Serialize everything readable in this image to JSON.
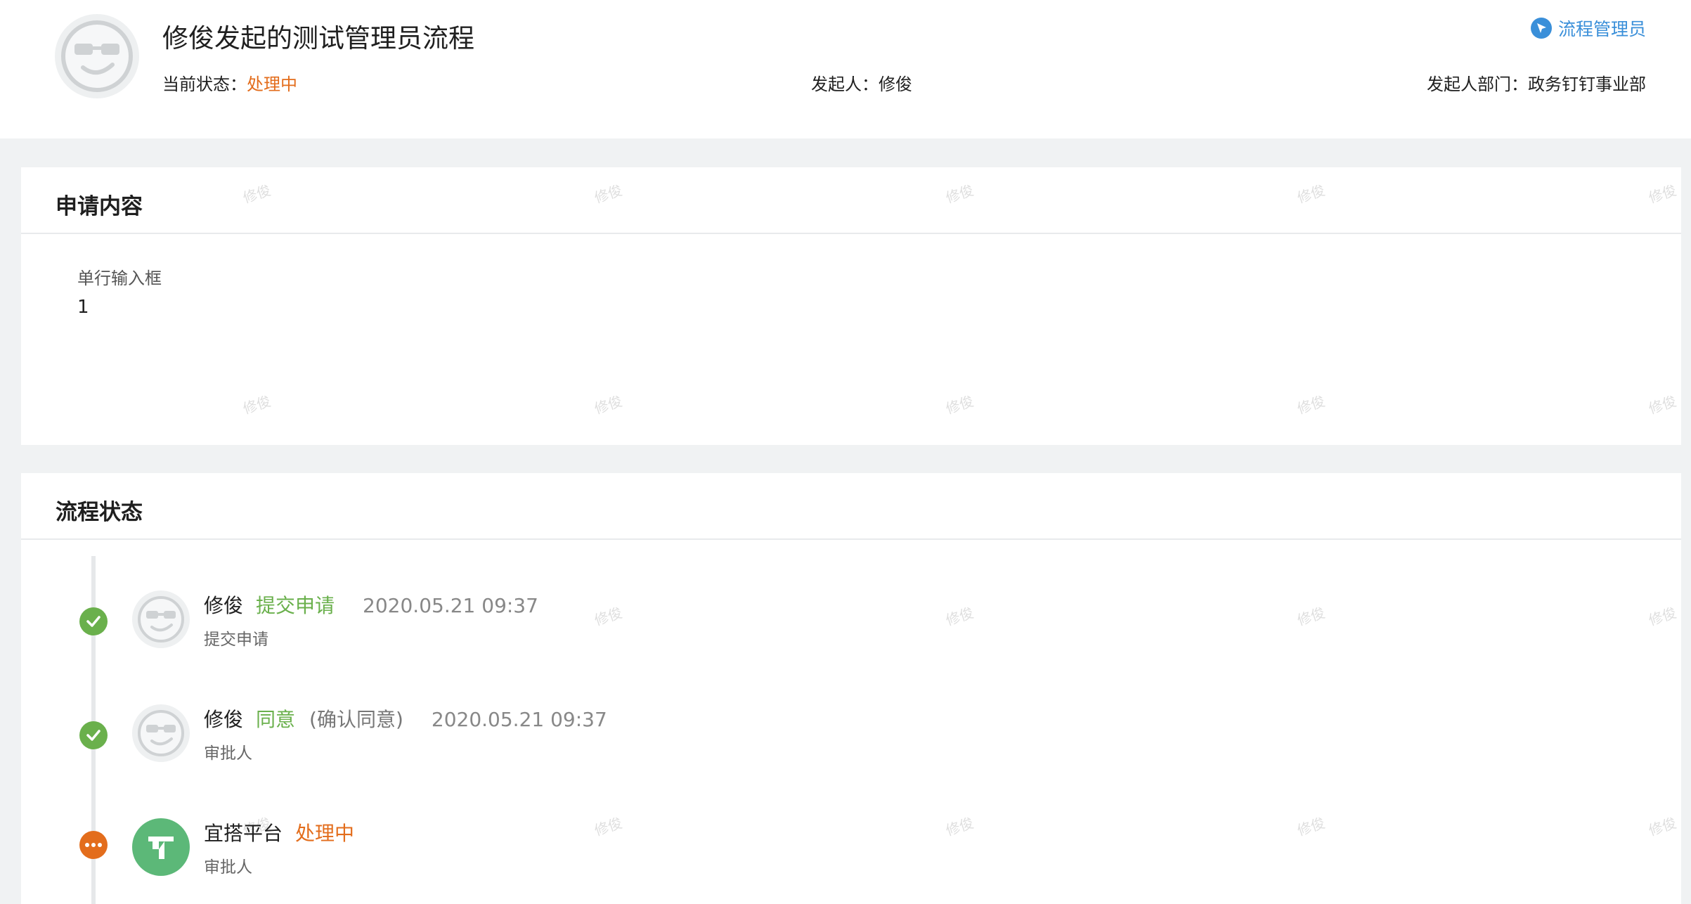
{
  "header": {
    "title": "修俊发起的测试管理员流程",
    "status_label": "当前状态：",
    "status_value": "处理中",
    "initiator_label": "发起人：",
    "initiator_value": "修俊",
    "dept_label": "发起人部门：",
    "dept_value": "政务钉钉事业部",
    "admin_link": "流程管理员",
    "avatar_icon": "sunglasses-face-icon"
  },
  "apply": {
    "title": "申请内容",
    "fields": [
      {
        "label": "单行输入框",
        "value": "1"
      }
    ]
  },
  "flow": {
    "title": "流程状态",
    "items": [
      {
        "name": "修俊",
        "action": "提交申请",
        "remark": "",
        "time": "2020.05.21 09:37",
        "role": "提交申请",
        "state": "done",
        "state_icon": "check-icon",
        "avatar_icon": "sunglasses-face-icon"
      },
      {
        "name": "修俊",
        "action": "同意",
        "remark": "(确认同意)",
        "time": "2020.05.21 09:37",
        "role": "审批人",
        "state": "done",
        "state_icon": "check-icon",
        "avatar_icon": "sunglasses-face-icon"
      },
      {
        "name": "宜搭平台",
        "action": "处理中",
        "remark": "",
        "time": "",
        "role": "审批人",
        "state": "pending",
        "state_icon": "more-dots-icon",
        "avatar_icon": "yida-logo-icon"
      }
    ]
  },
  "watermark": "修俊",
  "colors": {
    "accent_blue": "#3a8fd9",
    "processing_orange": "#e36d1c",
    "done_green": "#6ab04c",
    "yida_green": "#5cb878"
  }
}
